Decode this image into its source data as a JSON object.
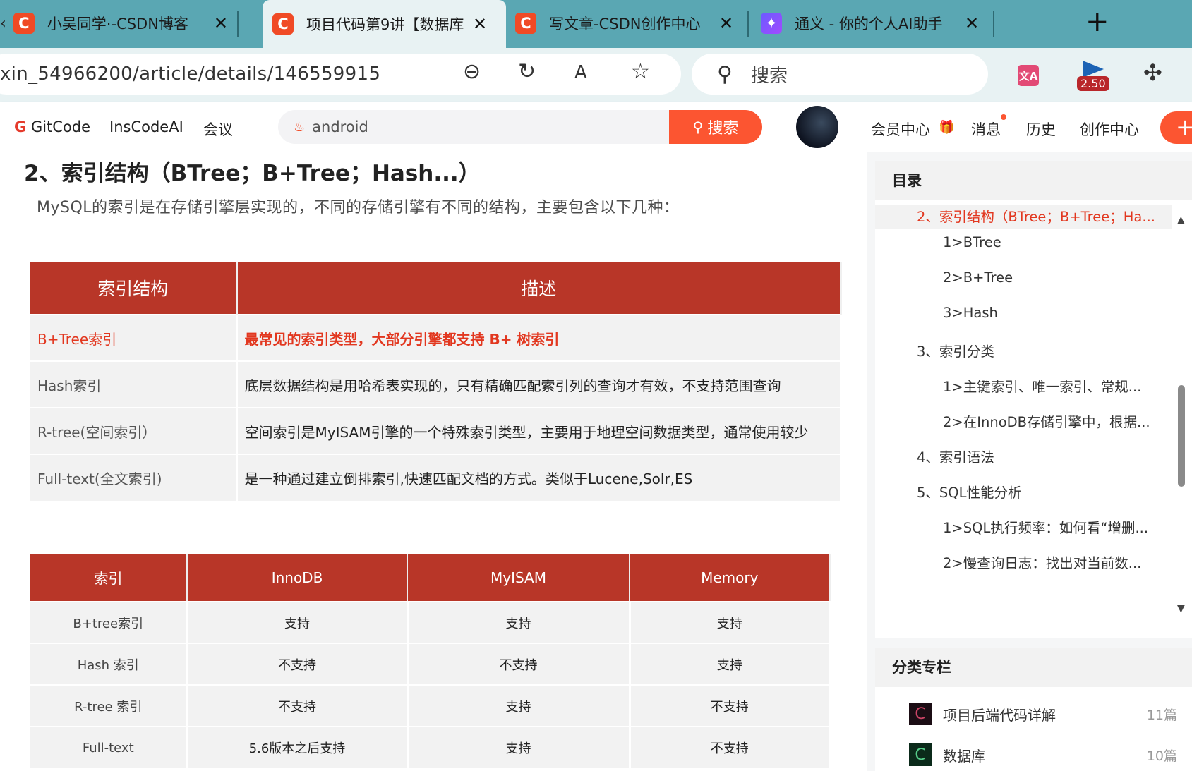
{
  "browser": {
    "tabs": [
      {
        "title": "小吴同学·-CSDN博客",
        "favicon": "C"
      },
      {
        "title": "项目代码第9讲【数据库",
        "favicon": "C"
      },
      {
        "title": "写文章-CSDN创作中心",
        "favicon": "C"
      },
      {
        "title": "通义 - 你的个人AI助手",
        "favicon": "✦"
      }
    ],
    "url": "xin_54966200/article/details/146559915",
    "search_placeholder": "搜索",
    "extension_badge": "2.50",
    "translate_label": "文A"
  },
  "site_header": {
    "nav": [
      "GitCode",
      "InsCodeAI",
      "会议"
    ],
    "search_value": "android",
    "search_button": "搜索",
    "right": [
      "会员中心",
      "消息",
      "历史",
      "创作中心"
    ],
    "create": "+"
  },
  "article": {
    "heading": "2、索引结构（BTree；B+Tree；Hash...）",
    "intro": "MySQL的索引是在存储引擎层实现的，不同的存储引擎有不同的结构，主要包含以下几种：",
    "table1": {
      "headers": [
        "索引结构",
        "描述"
      ],
      "rows": [
        [
          "B+Tree索引",
          "最常见的索引类型，大部分引擎都支持 B+ 树索引"
        ],
        [
          "Hash索引",
          "底层数据结构是用哈希表实现的，只有精确匹配索引列的查询才有效，不支持范围查询"
        ],
        [
          "R-tree(空间索引）",
          "空间索引是MyISAM引擎的一个特殊索引类型，主要用于地理空间数据类型，通常使用较少"
        ],
        [
          "Full-text(全文索引)",
          "是一种通过建立倒排索引,快速匹配文档的方式。类似于Lucene,Solr,ES"
        ]
      ]
    },
    "table2": {
      "headers": [
        "索引",
        "InnoDB",
        "MyISAM",
        "Memory"
      ],
      "rows": [
        [
          "B+tree索引",
          "支持",
          "支持",
          "支持"
        ],
        [
          "Hash 索引",
          "不支持",
          "不支持",
          "支持"
        ],
        [
          "R-tree 索引",
          "不支持",
          "支持",
          "不支持"
        ],
        [
          "Full-text",
          "5.6版本之后支持",
          "支持",
          "不支持"
        ]
      ]
    }
  },
  "sidebar": {
    "toc_title": "目录",
    "toc": [
      "2、索引结构（BTree；B+Tree；Ha...",
      "1>BTree",
      "2>B+Tree",
      "3>Hash",
      "3、索引分类",
      "1>主键索引、唯一索引、常规...",
      "2>在InnoDB存储引擎中，根据...",
      "4、索引语法",
      "5、SQL性能分析",
      "1>SQL执行频率：如何看“增删...",
      "2>慢查询日志：找出对当前数..."
    ],
    "category_title": "分类专栏",
    "categories": [
      {
        "name": "项目后端代码详解",
        "count": "11篇"
      },
      {
        "name": "数据库",
        "count": "10篇"
      }
    ]
  },
  "colors": {
    "accent": "#fc5531",
    "table_header": "#b83628",
    "tab_strip": "#5aa7b3"
  }
}
